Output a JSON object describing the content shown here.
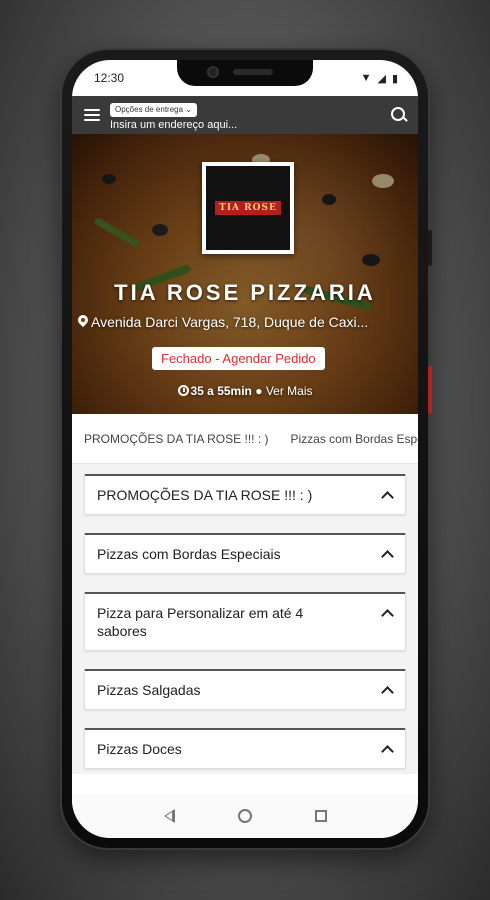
{
  "status_bar": {
    "time": "12:30"
  },
  "app_bar": {
    "delivery_option_label": "Opções de entrega ⌄",
    "address_placeholder": "Insira um endereço aqui..."
  },
  "hero": {
    "logo_text": "TIA ROSE",
    "restaurant_name": "TIA ROSE PIZZARIA",
    "address": "Avenida Darci Vargas, 718, Duque de Caxi...",
    "status": "Fechado - Agendar Pedido",
    "eta": "35 a 55min",
    "more_link": "Ver Mais"
  },
  "tabs": [
    "PROMOÇÕES DA TIA ROSE !!! : )",
    "Pizzas com Bordas Especiais"
  ],
  "sections": [
    {
      "title": "PROMOÇÕES DA TIA ROSE !!! : )"
    },
    {
      "title": "Pizzas com Bordas Especiais"
    },
    {
      "title": "Pizza para Personalizar em até 4 sabores"
    },
    {
      "title": "Pizzas Salgadas"
    },
    {
      "title": "Pizzas Doces"
    }
  ],
  "colors": {
    "app_bar": "#3a3a3a",
    "status_closed": "#d63030",
    "accent_red": "#b51e1e"
  }
}
